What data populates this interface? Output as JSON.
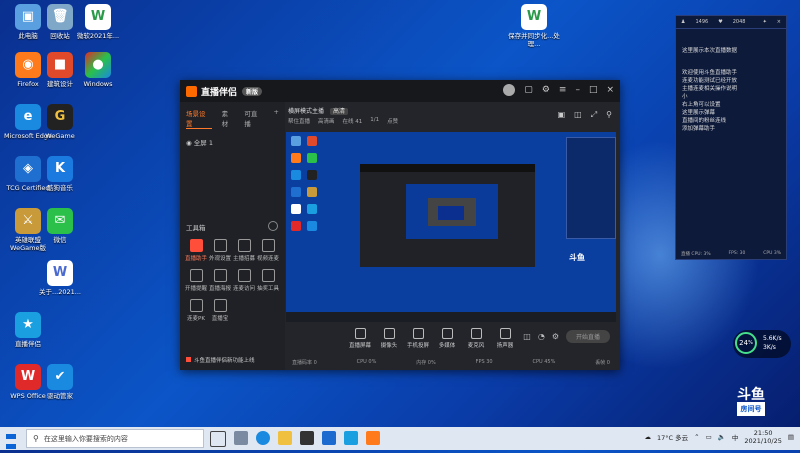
{
  "desktop": {
    "icons": [
      {
        "label": "此电脑",
        "color": "#5aa0e0",
        "glyph": "▣"
      },
      {
        "label": "回收站",
        "color": "#7fa7c8",
        "glyph": "🗑"
      },
      {
        "label": "Firefox",
        "color": "#ff7a1a",
        "glyph": "◉"
      },
      {
        "label": "Microsoft Edge",
        "color": "#1a8ae0",
        "glyph": "e"
      },
      {
        "label": "TCG Certified",
        "color": "#1f6fd0",
        "glyph": "◈"
      },
      {
        "label": "英雄联盟 WeGame版",
        "color": "#c89a3a",
        "glyph": "⚔"
      },
      {
        "label": "Windows",
        "color": "#3a78d0",
        "glyph": "◆"
      },
      {
        "label": "建筑设计",
        "color": "#e04a2a",
        "glyph": "■"
      },
      {
        "label": "WPS Office",
        "color": "#e02a2a",
        "glyph": "W"
      },
      {
        "label": "直播伴侣",
        "color": "#1aa0e0",
        "glyph": "★"
      },
      {
        "label": "WeGame",
        "color": "#222222",
        "glyph": "G"
      },
      {
        "label": "酷狗音乐",
        "color": "#1a7ae0",
        "glyph": "K"
      },
      {
        "label": "微信",
        "color": "#2ac04a",
        "glyph": "✉"
      },
      {
        "label": "关于...2021...",
        "color": "#ffffff",
        "glyph": "W"
      },
      {
        "label": "驱动管家",
        "color": "#1a8ae0",
        "glyph": "✔"
      }
    ],
    "top_files": [
      "微软2021年...",
      "保存并同步化...处理..."
    ]
  },
  "window": {
    "brand": "直播伴侣",
    "version": "新版",
    "tabs": [
      "场景设置",
      "素材",
      "可直播"
    ],
    "scene": "全屏 1",
    "top_info": "横屏模式主播",
    "top_badge": "高清",
    "top_stats": [
      "帮住直播",
      "高清画",
      "在线 41",
      "1/1",
      "点赞"
    ],
    "tools_title": "工具箱",
    "tools": [
      {
        "label": "直播助手",
        "hot": true
      },
      {
        "label": "外观设置",
        "hot": false
      },
      {
        "label": "主播招募",
        "hot": false
      },
      {
        "label": "视频连麦",
        "hot": false
      },
      {
        "label": "开播提醒",
        "hot": false
      },
      {
        "label": "直播海报",
        "hot": false
      },
      {
        "label": "连麦访问",
        "hot": false
      },
      {
        "label": "抽奖工具",
        "hot": false
      },
      {
        "label": "连麦PK",
        "hot": false
      },
      {
        "label": "直播宝",
        "hot": false
      }
    ],
    "tip": "斗鱼直播伴侣新功能上线",
    "bottom_buttons": [
      "直播屏幕",
      "摄像头",
      "手机投屏",
      "多媒体",
      "麦克风",
      "扬声器"
    ],
    "live_button": "开始直播",
    "status": [
      "直播码率 0",
      "CPU 0%",
      "内存 0%",
      "FPS 30",
      "CPU 45%",
      "丢帧 0"
    ]
  },
  "right_panel": {
    "header": [
      "1496",
      "2048"
    ],
    "lines": [
      "这里展示本次直播数据",
      "",
      "欢迎使用斗鱼直播助手",
      "连麦功能测试已经开放",
      "主播连麦相关操作说明",
      "小",
      "右上角可以设置",
      "这里展示弹幕",
      "直播间的粉丝连线",
      "添加弹幕助手"
    ],
    "footer": [
      "直播 CPU: 3%",
      "FPS: 30",
      "CPU 3%"
    ]
  },
  "cpu_widget": {
    "value": "24",
    "unit": "%",
    "up": "5.6K/s",
    "down": "3K/s"
  },
  "douyu_badge": {
    "name": "斗鱼",
    "sub": "房间号"
  },
  "taskbar": {
    "search_placeholder": "在这里输入你要搜索的内容",
    "weather": "17°C 多云",
    "time": "21:50",
    "date": "2021/10/25",
    "lang": "中"
  }
}
